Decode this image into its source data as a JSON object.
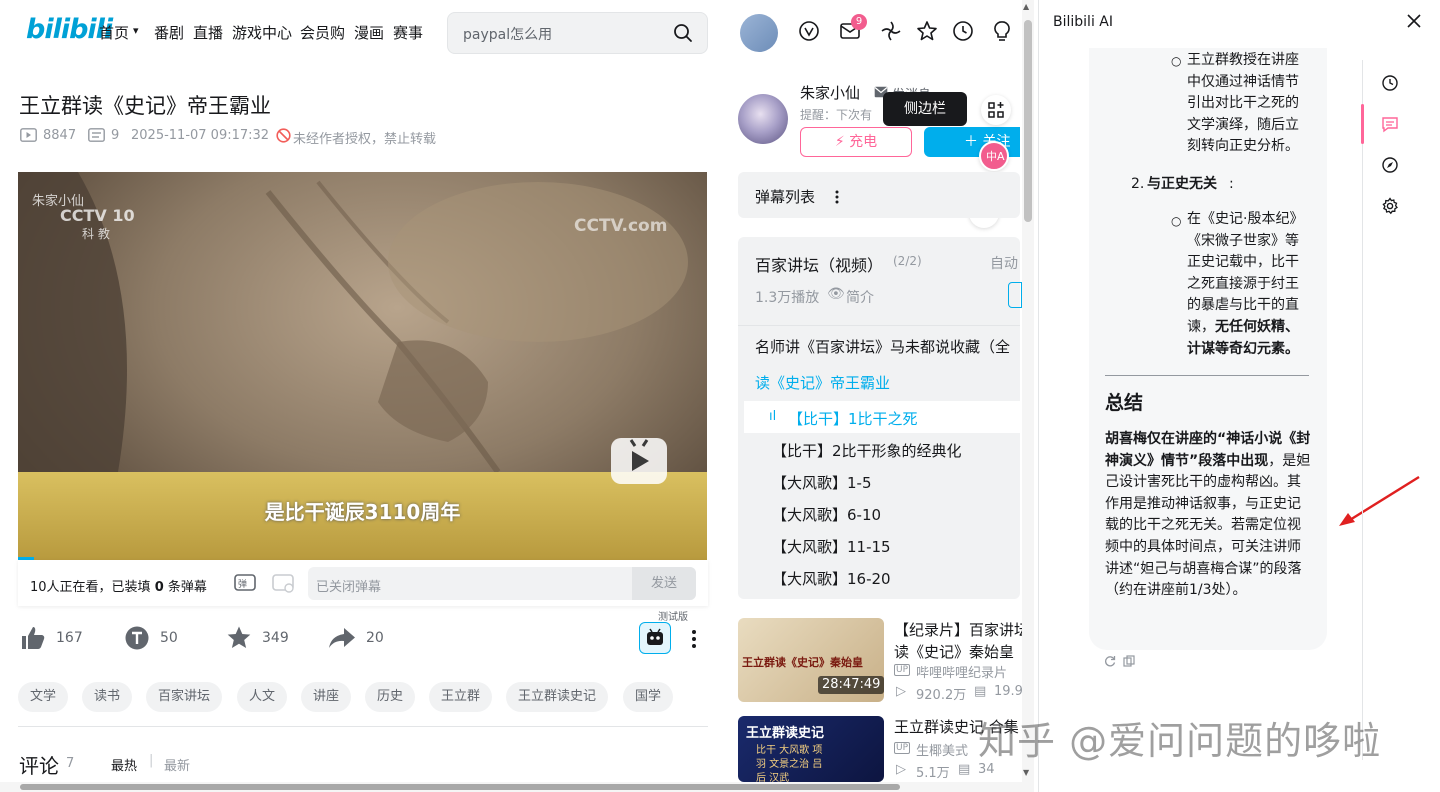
{
  "header": {
    "logo": "bilibili",
    "nav": [
      "首页",
      "番剧",
      "直播",
      "游戏中心",
      "会员购",
      "漫画",
      "赛事"
    ],
    "search_placeholder": "paypal怎么用",
    "message_badge": "9"
  },
  "video": {
    "title": "王立群读《史记》帝王霸业",
    "views": "8847",
    "danmaku_count": "9",
    "date": "2025-11-07 09:17:32",
    "copyright_note": "未经作者授权，禁止转载",
    "player_watermark": "朱家小仙",
    "channel_logo": "CCTV 10",
    "channel_sub": "科 教",
    "corner_logo": "CCTV.com",
    "subtitle": "是比干诞辰3110周年",
    "viewers_text_prefix": "10人正在看，已装填",
    "viewers_count": "0",
    "viewers_text_suffix": "条弹幕",
    "danmaku_placeholder": "已关闭弹幕",
    "send_label": "发送",
    "test_badge": "测试版"
  },
  "toolbar": {
    "like": "167",
    "coin": "50",
    "fav": "349",
    "share": "20"
  },
  "tags": [
    "文学",
    "读书",
    "百家讲坛",
    "人文",
    "讲座",
    "历史",
    "王立群",
    "王立群读史记",
    "国学"
  ],
  "comments": {
    "title": "评论",
    "count": "7",
    "sort_hot": "最热",
    "sort_new": "最新"
  },
  "uploader": {
    "name": "朱家小仙",
    "message_label": "发消息",
    "notice": "提醒：下次有",
    "charge_label": "充电",
    "follow_label": "关注",
    "tooltip": "侧边栏"
  },
  "danmaku_list": {
    "title": "弹幕列表"
  },
  "playlist": {
    "title": "百家讲坛（视频）",
    "progress": "(2/2)",
    "autoplay": "自动",
    "plays": "1.3万播放",
    "intro": "简介",
    "group_title": "名师讲《百家讲坛》马未都说收藏（全",
    "current_collection": "读《史记》帝王霸业",
    "episodes": [
      "【比干】1比干之死",
      "【比干】2比干形象的经典化",
      "【大风歌】1-5",
      "【大风歌】6-10",
      "【大风歌】11-15",
      "【大风歌】16-20"
    ]
  },
  "recommend": [
    {
      "title_l1": "【纪录片】百家讲坛",
      "title_l2": "读《史记》秦始皇",
      "uploader": "哔哩哔哩纪录片",
      "views": "920.2万",
      "danmaku": "19.9",
      "duration": "28:47:49",
      "thumb_text": "王立群读《史记》秦始皇"
    },
    {
      "title_l1": "王立群读史记 合集",
      "title_l2": "",
      "uploader": "生椰美式",
      "views": "5.1万",
      "danmaku": "34",
      "duration": "",
      "thumb_text": "王立群读史记",
      "thumb_sub": "比干 大风歌 项羽 文景之治 吕后 汉武"
    }
  ],
  "ai_panel": {
    "title": "Bilibili AI",
    "top_text": "王立群教授在讲座中仅通过神话情节引出对比干之死的文学演绎，随后立刻转向正史分析。",
    "point2_num": "2.",
    "point2_title": "与正史无关",
    "point2_text_a": "在《史记·殷本纪》《宋微子世家》等正史记载中，比干之死直接源于纣王的暴虐与比干的直谏，",
    "point2_text_b": "无任何妖精、计谋等奇幻元素。",
    "summary_title": "总结",
    "summary_bold": "胡喜梅仅在讲座的“神话小说《封神演义》情节”段落中出现",
    "summary_text": "，是妲己设计害死比干的虚构帮凶。其作用是推动神话叙事，与正史记载的比干之死无关。若需定位视频中的具体时间点，可关注讲师讲述“妲己与胡喜梅合谋”的段落（约在讲座前1/3处）。"
  },
  "watermark": "知乎 @爱问问题的哆啦",
  "colors": {
    "accent": "#00aeec",
    "pink": "#ff6699",
    "arrow": "#e02020"
  }
}
